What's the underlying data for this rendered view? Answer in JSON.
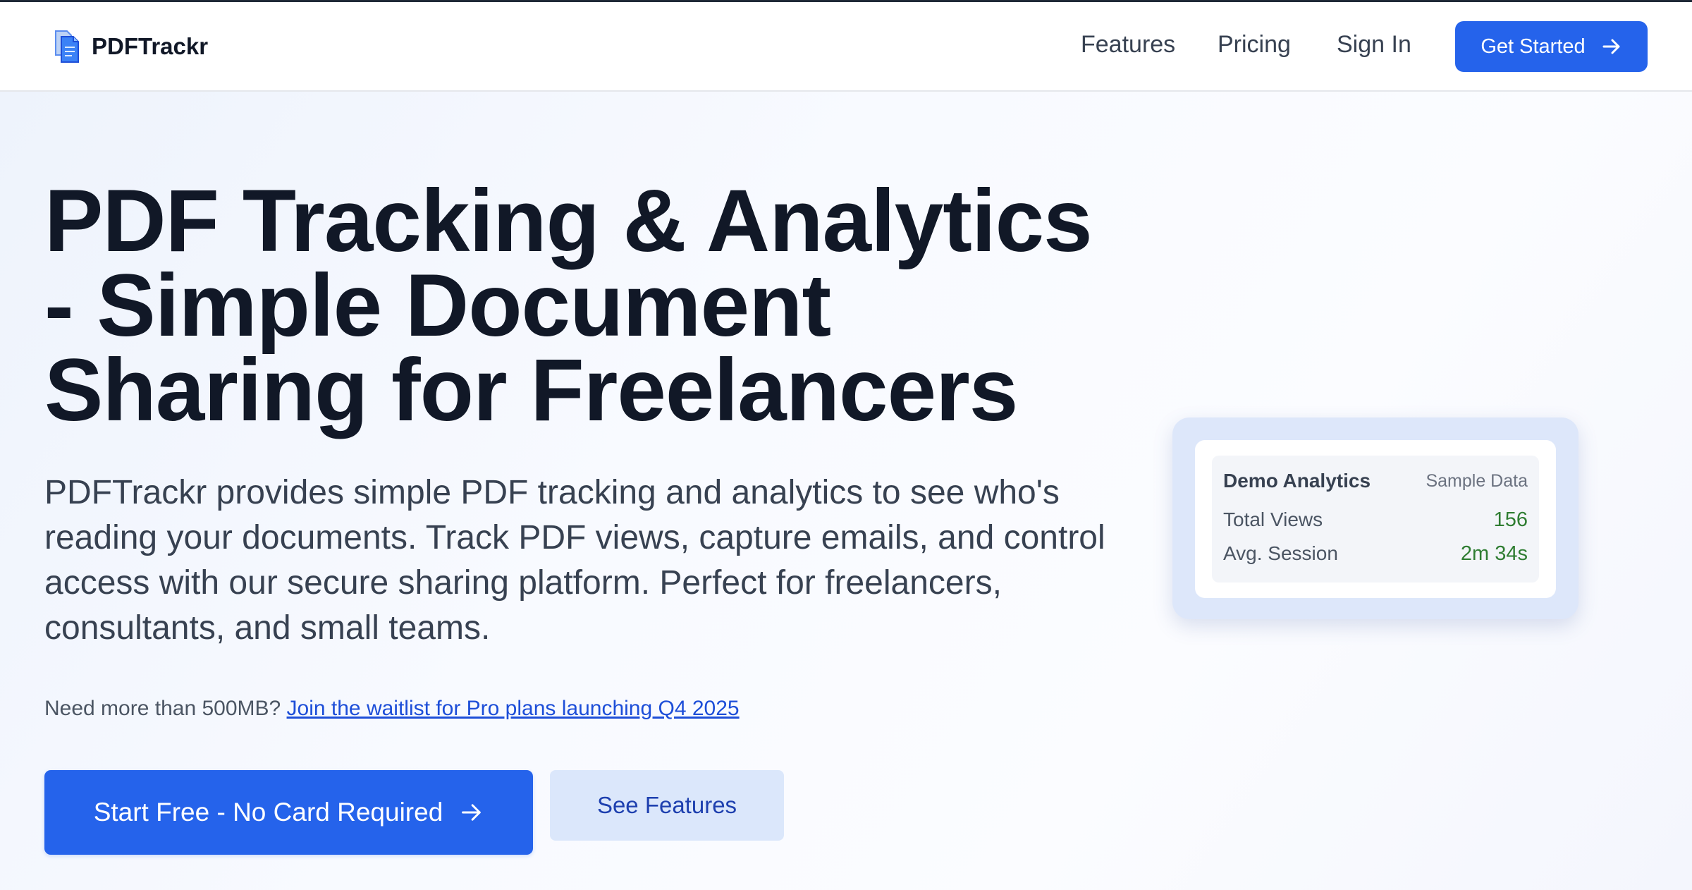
{
  "brand": {
    "name": "PDFTrackr"
  },
  "nav": {
    "links": [
      "Features",
      "Pricing",
      "Sign In"
    ],
    "cta_label": "Get Started"
  },
  "hero": {
    "headline_lines": [
      "PDF Tracking & Analytics",
      "- Simple Document",
      "Sharing for Freelancers"
    ],
    "subtext": "PDFTrackr provides simple PDF tracking and analytics to see who's reading your documents. Track PDF views, capture emails, and control access with our secure sharing platform. Perfect for freelancers, consultants, and small teams.",
    "waitlist_prefix": "Need more than 500MB?",
    "waitlist_link": "Join the waitlist for Pro plans launching Q4 2025",
    "primary_button": "Start Free - No Card Required",
    "secondary_button": "See Features"
  },
  "demo": {
    "title": "Demo Analytics",
    "badge": "Sample Data",
    "rows": [
      {
        "label": "Total Views",
        "value": "156"
      },
      {
        "label": "Avg. Session",
        "value": "2m 34s"
      }
    ]
  },
  "colors": {
    "accent": "#2563eb",
    "secondary_button_bg": "#dbe7fb",
    "stat_value": "#2f7d32"
  },
  "icons": {
    "logo": "document-icon",
    "nav_cta": "arrow-right-icon",
    "primary_button": "arrow-right-icon"
  }
}
